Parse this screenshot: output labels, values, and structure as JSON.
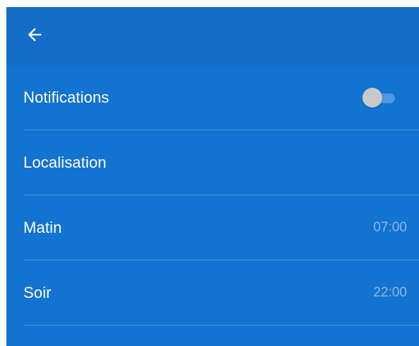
{
  "header": {
    "back_icon": "arrow-left-icon"
  },
  "settings": {
    "items": [
      {
        "label": "Notifications",
        "toggle": {
          "on": false
        }
      },
      {
        "label": "Localisation"
      },
      {
        "label": "Matin",
        "value": "07:00"
      },
      {
        "label": "Soir",
        "value": "22:00"
      }
    ]
  },
  "colors": {
    "background": "#1273d0",
    "header": "#146ec8",
    "text": "#ffffff",
    "value_text": "#8fb7e6",
    "divider": "#4f93d8",
    "toggle_track": "#4f96e4",
    "toggle_thumb": "#c9c9c9"
  }
}
